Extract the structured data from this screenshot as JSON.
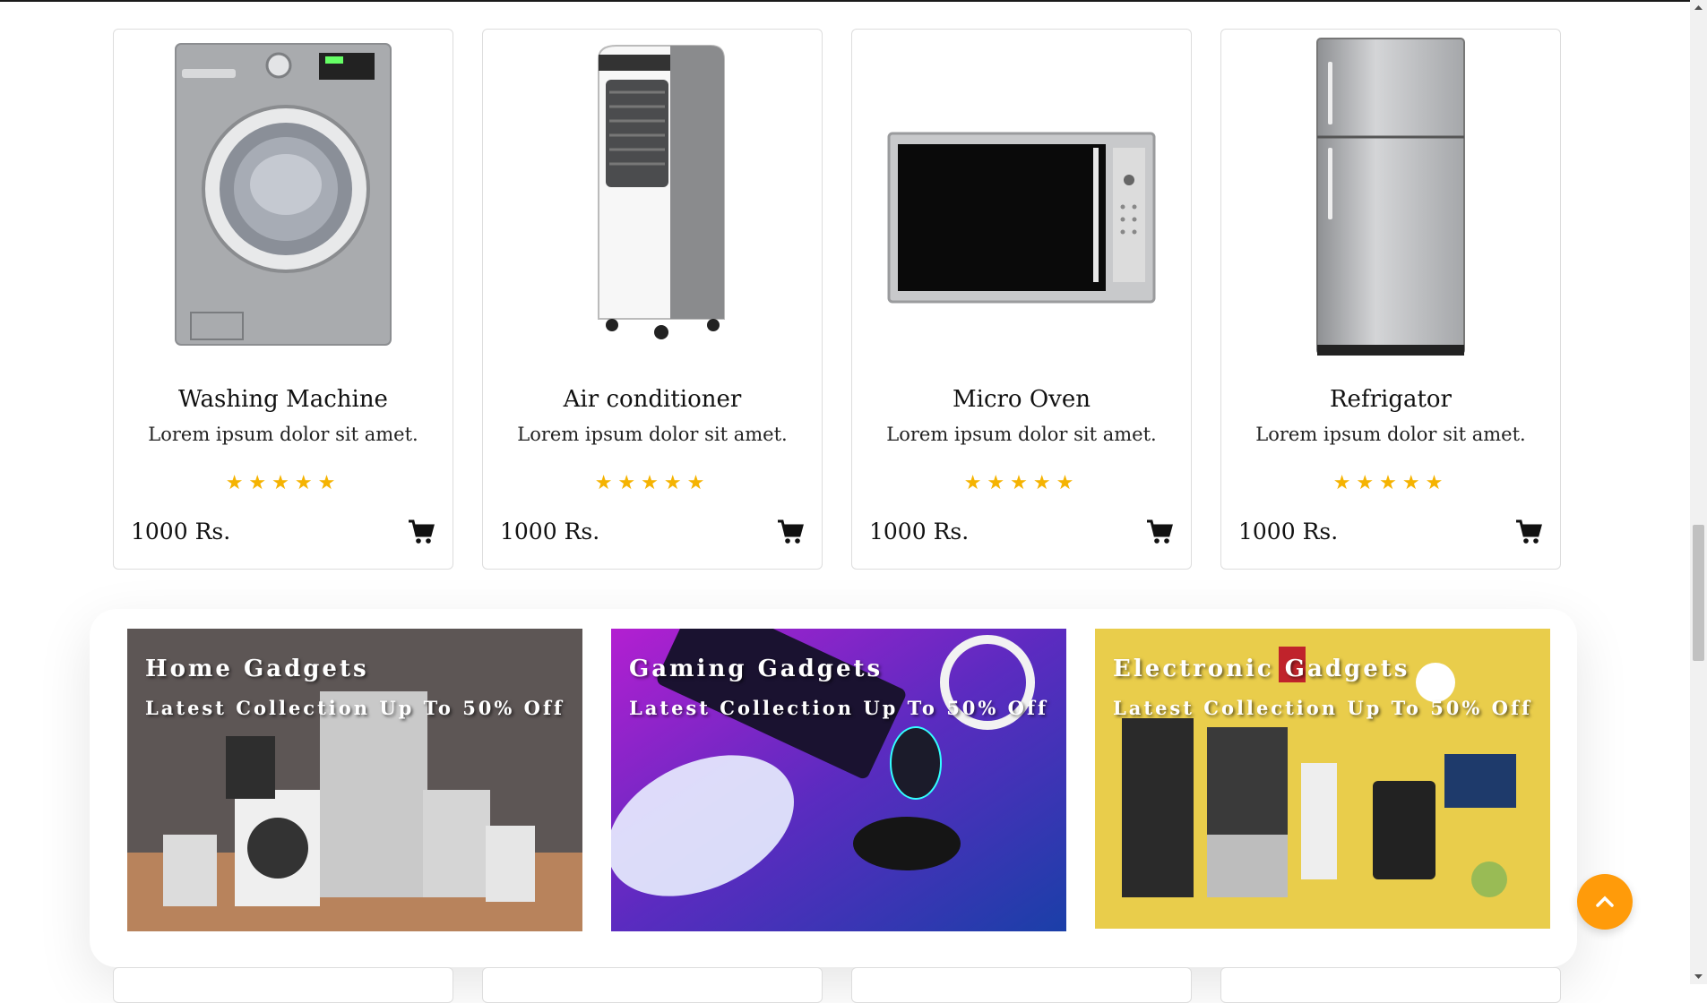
{
  "products": [
    {
      "title": "Washing Machine",
      "description": "Lorem ipsum dolor sit amet.",
      "rating": "★★★★★",
      "price": "1000 Rs.",
      "image": "washing-machine"
    },
    {
      "title": "Air conditioner",
      "description": "Lorem ipsum dolor sit amet.",
      "rating": "★★★★★",
      "price": "1000 Rs.",
      "image": "air-cooler"
    },
    {
      "title": "Micro Oven",
      "description": "Lorem ipsum dolor sit amet.",
      "rating": "★★★★★",
      "price": "1000 Rs.",
      "image": "microwave-oven"
    },
    {
      "title": "Refrigator",
      "description": "Lorem ipsum dolor sit amet.",
      "rating": "★★★★★",
      "price": "1000 Rs.",
      "image": "refrigerator"
    }
  ],
  "banners": [
    {
      "title": "Home Gadgets",
      "subtitle": "Latest Collection Up To 50% Off",
      "image": "home-appliances-photo"
    },
    {
      "title": "Gaming Gadgets",
      "subtitle": "Latest Collection Up To 50% Off",
      "image": "gaming-accessories-photo"
    },
    {
      "title": "Electronic Gadgets",
      "subtitle": "Latest Collection Up To 50% Off",
      "image": "electronics-flatlay-photo"
    }
  ],
  "icons": {
    "cart": "shopping-cart-icon",
    "star": "star-icon",
    "scroll_top": "chevron-up-icon"
  },
  "colors": {
    "star": "#f5b301",
    "scroll_top_button": "#ff9b0a"
  }
}
